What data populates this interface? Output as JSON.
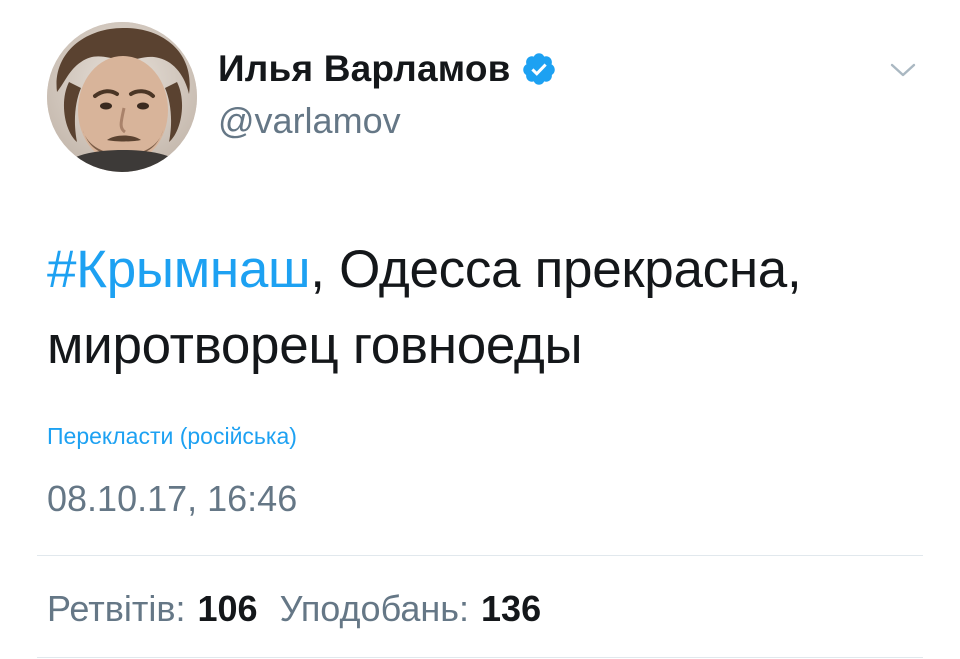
{
  "author": {
    "display_name": "Илья Варламов",
    "handle": "@varlamov",
    "verified": true,
    "avatar": "avatar-photo"
  },
  "tweet": {
    "hashtag": "#Крымнаш",
    "text_after_hashtag": ", Одесса прекрасна, миротворец говноеды",
    "translate_label": "Перекласти (російська)",
    "timestamp": "08.10.17, 16:46"
  },
  "stats": {
    "retweets_label": "Ретвітів:",
    "retweets_value": "106",
    "likes_label": "Уподобань:",
    "likes_value": "136"
  },
  "icons": {
    "verified": "verified-badge-icon",
    "menu": "chevron-down-icon"
  },
  "colors": {
    "link": "#1da1f2",
    "text": "#14171a",
    "secondary": "#657786",
    "divider": "#e1e8ed"
  }
}
